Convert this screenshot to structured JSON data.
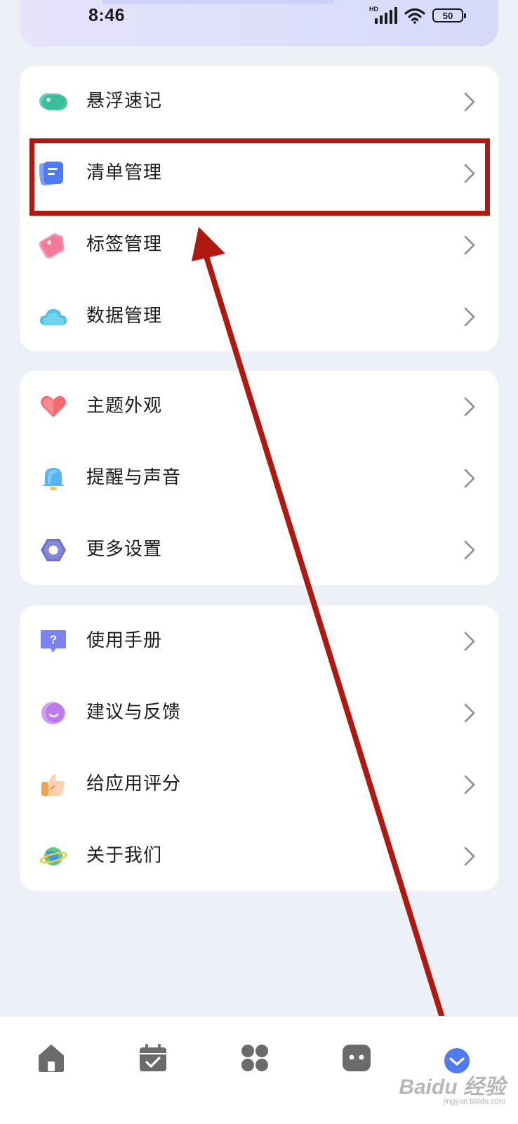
{
  "status_bar": {
    "time": "8:46",
    "network": "HD",
    "battery": "50"
  },
  "menu_groups": [
    {
      "items": [
        {
          "label": "悬浮速记",
          "icon": "floating-note-icon"
        },
        {
          "label": "清单管理",
          "icon": "list-manage-icon"
        },
        {
          "label": "标签管理",
          "icon": "tag-icon"
        },
        {
          "label": "数据管理",
          "icon": "cloud-icon"
        }
      ]
    },
    {
      "items": [
        {
          "label": "主题外观",
          "icon": "heart-icon"
        },
        {
          "label": "提醒与声音",
          "icon": "bell-icon"
        },
        {
          "label": "更多设置",
          "icon": "hex-settings-icon"
        }
      ]
    },
    {
      "items": [
        {
          "label": "使用手册",
          "icon": "help-icon"
        },
        {
          "label": "建议与反馈",
          "icon": "feedback-icon"
        },
        {
          "label": "给应用评分",
          "icon": "thumbs-up-icon"
        },
        {
          "label": "关于我们",
          "icon": "planet-icon"
        }
      ]
    }
  ],
  "bottom_nav": [
    {
      "icon": "home-icon"
    },
    {
      "icon": "calendar-check-icon"
    },
    {
      "icon": "apps-grid-icon"
    },
    {
      "icon": "chat-bubble-icon"
    },
    {
      "icon": "profile-icon"
    }
  ],
  "watermark": {
    "brand": "Baidu 经验",
    "url": "jingyan.baidu.com"
  },
  "colors": {
    "background": "#ECF0F7",
    "card": "#FFFFFF",
    "annotation": "#B0190F",
    "active_nav": "#4F7BF0",
    "inactive_nav": "#6B6B6B"
  }
}
